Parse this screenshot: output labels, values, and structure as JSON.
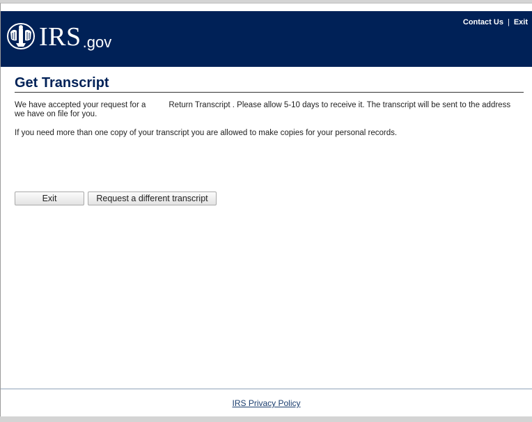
{
  "header": {
    "logo_text": "IRS",
    "logo_suffix": ".gov",
    "links": {
      "contact_us": "Contact Us",
      "separator": "|",
      "exit": "Exit"
    }
  },
  "main": {
    "title": "Get Transcript",
    "message_part1": "We have accepted your request for a",
    "transcript_type": "Return Transcript",
    "message_part2": ". Please allow 5-10 days to receive it. The transcript will be sent to the address we have on file for you.",
    "message_copies": "If you need more than one copy of your transcript you are allowed to make copies for your personal records."
  },
  "buttons": {
    "exit": "Exit",
    "request_different": "Request a different transcript"
  },
  "footer": {
    "privacy_policy": "IRS Privacy Policy"
  },
  "colors": {
    "header_bg": "#002157",
    "title_color": "#002157",
    "link_color": "#1a3d6e"
  },
  "icons": {
    "logo": "irs-eagle-icon"
  }
}
